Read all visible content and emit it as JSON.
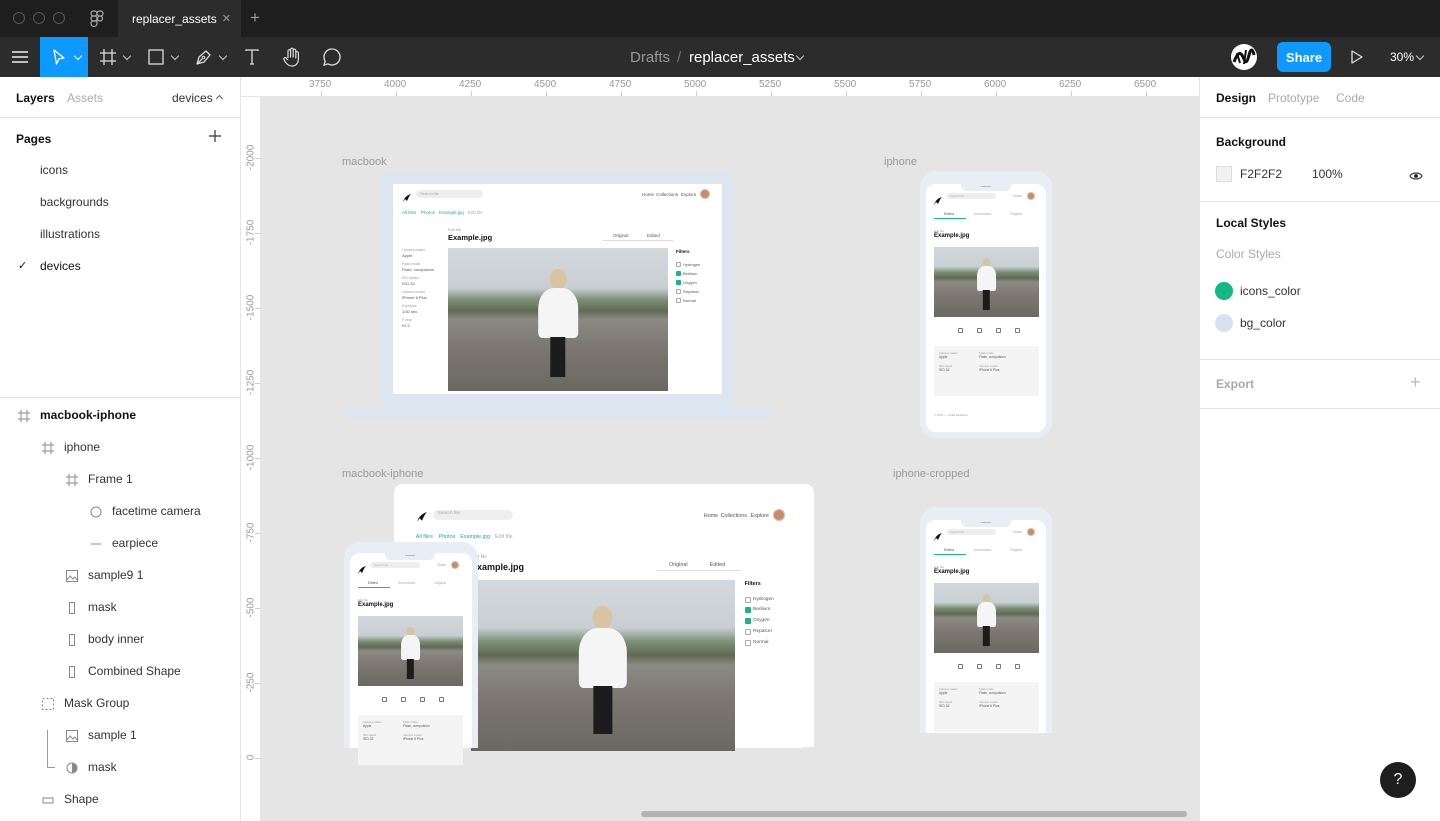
{
  "tab": {
    "title": "replacer_assets",
    "close": "×",
    "new": "+"
  },
  "toolbar": {
    "breadcrumb_root": "Drafts",
    "breadcrumb_sep": "/",
    "file_name": "replacer_assets",
    "share": "Share",
    "zoom": "30%"
  },
  "left": {
    "tabs": {
      "layers": "Layers",
      "assets": "Assets",
      "page_select": "devices"
    },
    "pages_title": "Pages",
    "pages": [
      {
        "label": "icons"
      },
      {
        "label": "backgrounds"
      },
      {
        "label": "illustrations"
      },
      {
        "label": "devices",
        "check": "✓"
      }
    ],
    "layers": [
      {
        "label": "macbook-iphone",
        "icon": "frame"
      },
      {
        "label": "iphone",
        "icon": "frame"
      },
      {
        "label": "Frame 1",
        "icon": "frame"
      },
      {
        "label": "facetime camera",
        "icon": "ellipse"
      },
      {
        "label": "earpiece",
        "icon": "line"
      },
      {
        "label": "sample9 1",
        "icon": "image"
      },
      {
        "label": "mask",
        "icon": "rect"
      },
      {
        "label": "body inner",
        "icon": "rect"
      },
      {
        "label": "Combined Shape",
        "icon": "rect"
      },
      {
        "label": "Mask Group",
        "icon": "group"
      },
      {
        "label": "sample 1",
        "icon": "image"
      },
      {
        "label": "mask",
        "icon": "mask"
      },
      {
        "label": "Shape",
        "icon": "shape"
      }
    ]
  },
  "rulers": {
    "h": [
      "3750",
      "4000",
      "4250",
      "4500",
      "4750",
      "5000",
      "5250",
      "5500",
      "5750",
      "6000",
      "6250",
      "6500"
    ],
    "v": [
      "-2000",
      "-1750",
      "-1500",
      "-1250",
      "-1000",
      "-750",
      "-500",
      "-250",
      "0"
    ]
  },
  "canvas": {
    "frames": {
      "macbook": "macbook",
      "iphone": "iphone",
      "macbook_iphone": "macbook-iphone",
      "iphone_cropped": "iphone-cropped"
    },
    "mock": {
      "search": "Search file",
      "nav1": "Home",
      "nav2": "Collections",
      "nav3": "Explore",
      "crumb1": "All files",
      "crumb2": "Photos",
      "crumb3": "Example.jpg",
      "crumb4": "Edit file",
      "edit_label": "Edit file",
      "file_title": "Example.jpg",
      "tab_original": "Original",
      "tab_edited": "Edited",
      "tab_info": "Information",
      "filters_title": "Filters",
      "filters": [
        {
          "label": "Hydrogen",
          "on": false
        },
        {
          "label": "Berilium",
          "on": true
        },
        {
          "label": "Oxygen",
          "on": true
        },
        {
          "label": "Repalcer",
          "on": false
        },
        {
          "label": "Normal",
          "on": false
        }
      ],
      "meta": [
        {
          "k": "Camera maker",
          "v": "Apple"
        },
        {
          "k": "Flash mode",
          "v": "Flash, compulsion"
        },
        {
          "k": "ISO speed",
          "v": "ISO-32"
        },
        {
          "k": "Camera model",
          "v": "iPhone 6 Plus"
        },
        {
          "k": "Exposure",
          "v": "1/30 sec."
        },
        {
          "k": "F-stop",
          "v": "f/2.2"
        }
      ],
      "phone_close": "Close",
      "footer": "© 2017 — 2018 Replacer"
    }
  },
  "right": {
    "tabs": {
      "design": "Design",
      "prototype": "Prototype",
      "code": "Code"
    },
    "background_title": "Background",
    "bg_hex": "F2F2F2",
    "bg_opacity": "100%",
    "local_styles_title": "Local Styles",
    "color_styles": "Color Styles",
    "styles": [
      {
        "name": "icons_color",
        "color": "#14b887"
      },
      {
        "name": "bg_color",
        "color": "#d6e2f0"
      }
    ],
    "export_title": "Export",
    "export_add": "+"
  },
  "help": "?",
  "colors": {
    "accent": "#0d99ff",
    "canvas": "#e5e5e5",
    "teal": "#1bb28c"
  }
}
